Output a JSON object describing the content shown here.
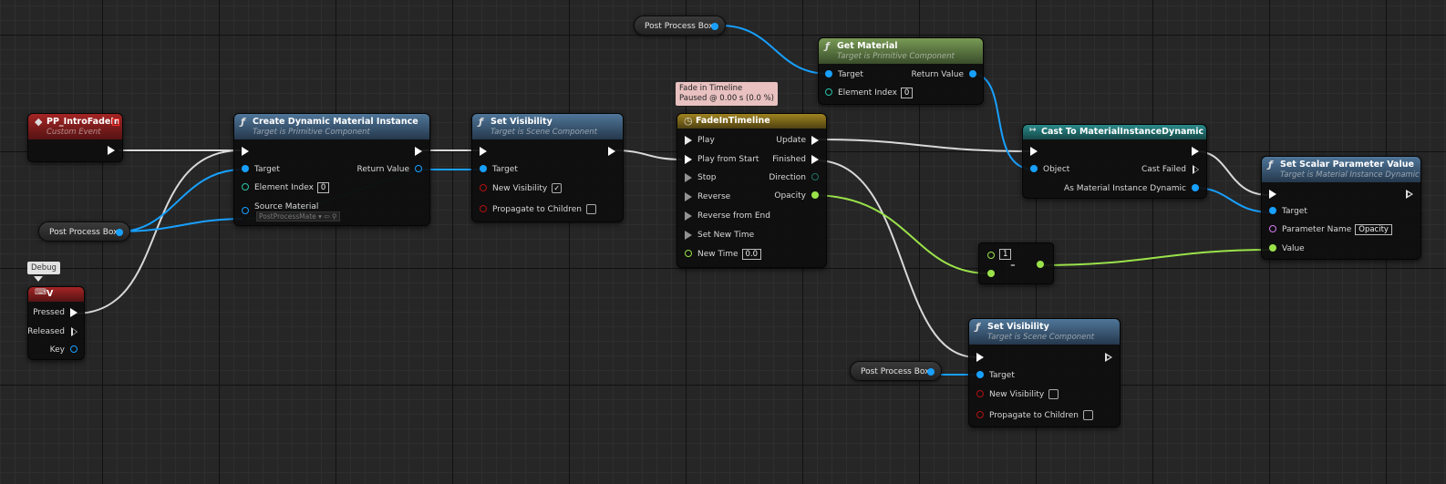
{
  "nodes": {
    "get_material": {
      "title": "Get Material",
      "subtitle": "Target is Primitive Component",
      "target": "Target",
      "return_value": "Return Value",
      "element_index": "Element Index",
      "element_index_value": "0"
    },
    "pp_event": {
      "title": "PP_IntroFadeIn",
      "subtitle": "Custom Event"
    },
    "create_dmi": {
      "title": "Create Dynamic Material Instance",
      "subtitle": "Target is Primitive Component",
      "target": "Target",
      "return_value": "Return Value",
      "element_index": "Element Index",
      "element_index_value": "0",
      "source_material": "Source Material",
      "source_material_value": "PostProcessMate"
    },
    "set_vis_1": {
      "title": "Set Visibility",
      "subtitle": "Target is Scene Component",
      "target": "Target",
      "new_visibility": "New Visibility",
      "propagate": "Propagate to Children"
    },
    "timeline": {
      "title": "FadeInTimeline",
      "play": "Play",
      "play_from_start": "Play from Start",
      "stop": "Stop",
      "reverse": "Reverse",
      "reverse_from_end": "Reverse from End",
      "set_new_time": "Set New Time",
      "new_time": "New Time",
      "new_time_value": "0.0",
      "update": "Update",
      "finished": "Finished",
      "direction": "Direction",
      "opacity": "Opacity"
    },
    "cast": {
      "title": "Cast To MaterialInstanceDynamic",
      "object": "Object",
      "cast_failed": "Cast Failed",
      "as_mid": "As Material Instance Dynamic"
    },
    "set_scalar": {
      "title": "Set Scalar Parameter Value",
      "subtitle": "Target is Material Instance Dynamic",
      "target": "Target",
      "param_name": "Parameter Name",
      "param_name_value": "Opacity",
      "value": "Value"
    },
    "minus": {
      "value": "1",
      "symbol": "-"
    },
    "set_vis_2": {
      "title": "Set Visibility",
      "subtitle": "Target is Scene Component",
      "target": "Target",
      "new_visibility": "New Visibility",
      "propagate": "Propagate to Children"
    },
    "key_v": {
      "title": "V",
      "pressed": "Pressed",
      "released": "Released",
      "key": "Key"
    }
  },
  "variables": {
    "ppb_top": "Post Process Box",
    "ppb_left": "Post Process Box",
    "ppb_bottom": "Post Process Box"
  },
  "comments": {
    "debug": "Debug",
    "timeline_line1": "Fade in Timeline",
    "timeline_line2": "Paused @ 0.00 s (0.0 %)"
  },
  "colors": {
    "exec": "#ffffff",
    "object": "#18a0ff",
    "float": "#9ae24a",
    "int": "#29c3a8",
    "bool": "#b01010",
    "name": "#d67cf0"
  }
}
